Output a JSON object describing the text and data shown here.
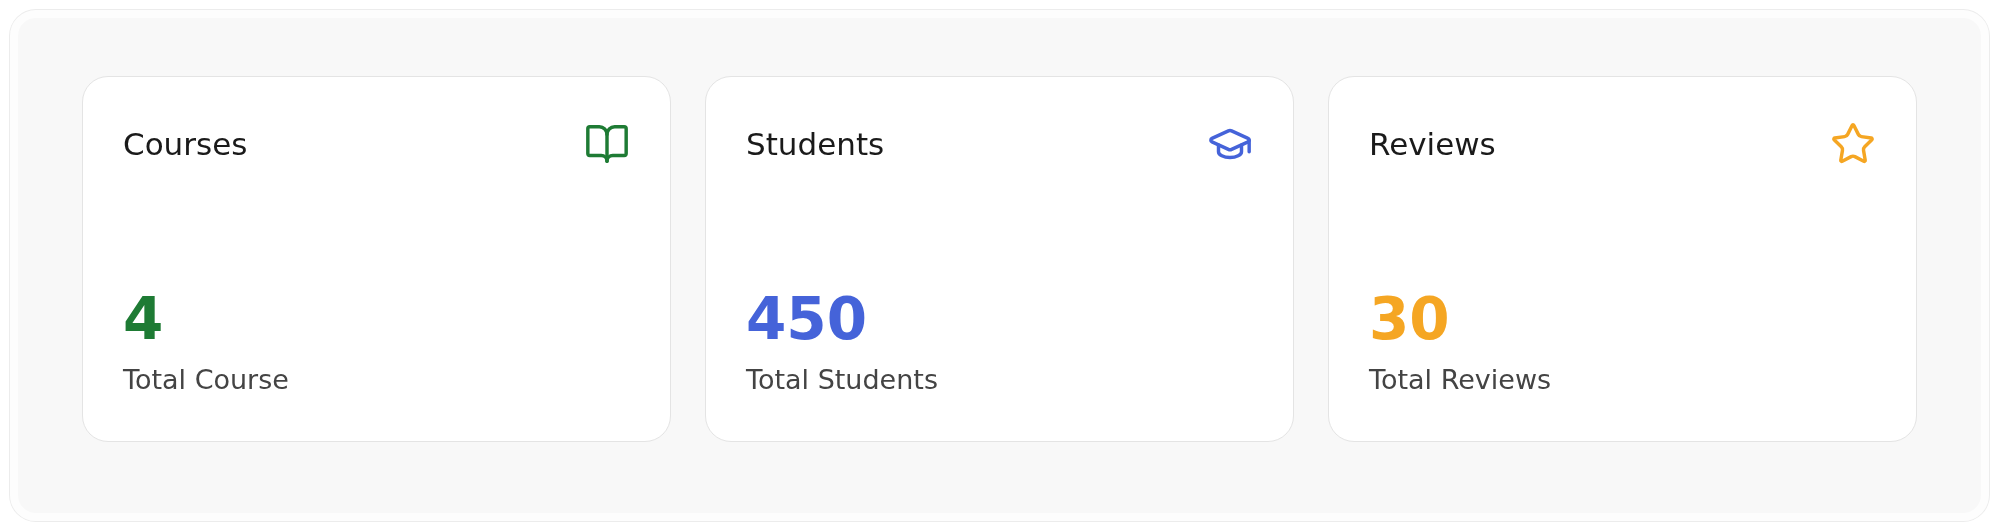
{
  "cards": [
    {
      "title": "Courses",
      "kind": "book",
      "color": "#1e7b34",
      "value": "4",
      "caption": "Total Course"
    },
    {
      "title": "Students",
      "kind": "graduation",
      "color": "#4563d9",
      "value": "450",
      "caption": "Total Students"
    },
    {
      "title": "Reviews",
      "kind": "star",
      "color": "#f5a623",
      "value": "30",
      "caption": "Total Reviews"
    }
  ]
}
